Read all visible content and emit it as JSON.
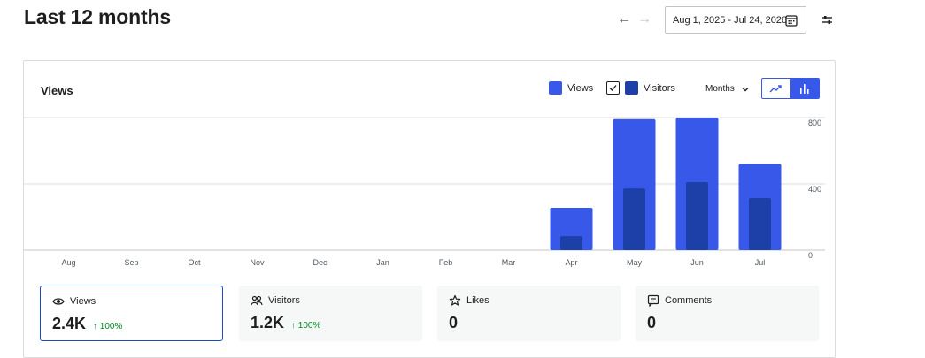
{
  "header": {
    "title": "Last 12 months",
    "date_range": "Aug 1, 2025 - Jul 24, 2026"
  },
  "card": {
    "title": "Views",
    "legend": [
      {
        "label": "Views",
        "color": "#3858e9"
      },
      {
        "label": "Visitors",
        "color": "#1d3fa8",
        "checked": true
      }
    ],
    "period_label": "Months"
  },
  "chart_data": {
    "type": "bar",
    "categories": [
      "Aug",
      "Sep",
      "Oct",
      "Nov",
      "Dec",
      "Jan",
      "Feb",
      "Mar",
      "Apr",
      "May",
      "Jun",
      "Jul"
    ],
    "series": [
      {
        "name": "Views",
        "color": "#3858e9",
        "values": [
          0,
          0,
          0,
          0,
          0,
          0,
          0,
          0,
          256,
          791,
          800,
          521
        ]
      },
      {
        "name": "Visitors",
        "color": "#1d3fa8",
        "values": [
          0,
          0,
          0,
          0,
          0,
          0,
          0,
          0,
          85,
          373,
          411,
          315
        ]
      }
    ],
    "y_ticks": [
      "0",
      "400",
      "800"
    ],
    "ylim": [
      0,
      800
    ],
    "grid": true
  },
  "stats": [
    {
      "label": "Views",
      "value": "2.4K",
      "delta": "↑ 100%",
      "icon": "eye-icon",
      "active": true
    },
    {
      "label": "Visitors",
      "value": "1.2K",
      "delta": "↑ 100%",
      "icon": "people-icon",
      "active": false
    },
    {
      "label": "Likes",
      "value": "0",
      "delta": "",
      "icon": "star-icon",
      "active": false
    },
    {
      "label": "Comments",
      "value": "0",
      "delta": "",
      "icon": "comment-icon",
      "active": false
    }
  ]
}
